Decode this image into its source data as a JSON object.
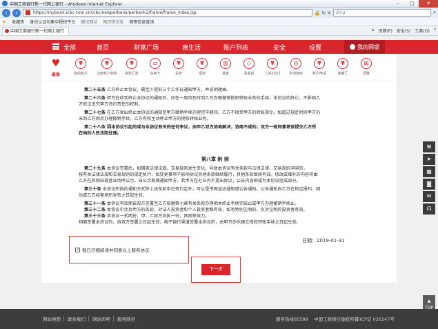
{
  "browser": {
    "title": "中国工商银行新一代网上银行 - Windows Internet Explorer",
    "url": "https://mybank.icbc.com.cn/icbc/newperbank/perbank3/frame/frame_index.jsp",
    "search_placeholder": "Bing",
    "favorites_label": "收藏夹",
    "favorites": [
      "身份认证与集中授权平台",
      "建议网站",
      "网页快讯库",
      "邮寄信息查询"
    ],
    "tab_title": "中国工商银行新一代网上银行",
    "commands": [
      "页面(P)",
      "安全(S)",
      "工具(O)"
    ]
  },
  "nav": {
    "all": "全部",
    "items": [
      "首页",
      "财富广场",
      "惠生活",
      "账户列表",
      "安全",
      "设置"
    ],
    "mybank": "我的网银"
  },
  "quick": [
    {
      "label": "最爱",
      "icon": "♥"
    },
    {
      "label": "我的账户",
      "icon": "¥"
    },
    {
      "label": "注册账户转账",
      "icon": "¥"
    },
    {
      "label": "转账汇款",
      "icon": "¥"
    },
    {
      "label": "信用卡",
      "icon": "▭"
    },
    {
      "label": "贷款",
      "icon": "¥"
    },
    {
      "label": "理财",
      "icon": "¥"
    },
    {
      "label": "基金",
      "icon": "▥"
    },
    {
      "label": "贵金属",
      "icon": "◇"
    },
    {
      "label": "工资e支付",
      "icon": "¥"
    },
    {
      "label": "本地特色",
      "icon": "◎"
    },
    {
      "label": "账户申请",
      "icon": "¥"
    },
    {
      "label": "储蓄汇",
      "icon": "¥"
    },
    {
      "label": "调整",
      "icon": "⊞"
    }
  ],
  "agreement": {
    "p25_head": "第二十五条",
    "p25": "乙方终止本协议，需至少提前三个工作日通知甲方，并说明理由。",
    "p26_head": "第二十六条",
    "p26a": "甲方在收到终止本协议的通知后，应在一周内及时到乙方办理撤销授权转账业务的手续。本协议的终止，不影响乙",
    "p26b": "方依法追究甲方违约责任的权利。",
    "p27_head": "第二十七条",
    "p27a": "在乙方发出终止本协议的通知至甲方撤销手续办理完毕期间，乙方不接受甲方的转账指令。如超过规定时间甲方仍",
    "p27b": "未到乙方网点办理撤销手续，乙方有权主动停止甲方的授权转账业务。",
    "p28_head": "第二十八条",
    "p28a": "因本协议引起的或与本协议有关的任何争议，由甲乙双方协商解决；协商不成的，双方一致同意将该提交乙方所",
    "p28b": "在地的人民法院处理。",
    "chapter8": "第八章 附 则",
    "p29_head": "第二十九条",
    "p29a": "本协议签署后，如国家法律法规、交易规则发生变化，导致本协议有关条款与法律法律、交易规则冲突的，",
    "p29b": "按有关法律法规和交易规则的规定执行，如变更事项不影响协议其他条款继续履行，其他条款继续有效。修改或增补的内容将由",
    "p29c": "乙方在其网站或营业场所公示，自公示期满通知甲方，若甲方在七日内不提出异议，公告内容即成为本协议组成部分。",
    "p30_head": "第三十条",
    "p30a": "本协议所指的通知方式除上述条款中已有约定外，可以是书面送达通知或公告通知。公告通知自乙方在指定报刊、网",
    "p30b": "站或乙方经营场所发布之日起生效。",
    "p31_head": "第三十一条",
    "p31": "本协议有效期自双方签署至乙方依据第七章有关条款办理相关终止手续完结止或甲方办理撤销手续止。",
    "p32_head": "第三十二条",
    "p32": "本协议中涉及甲方的条款，对法人投资者和个人投资者都有效，如有特别注明的，仅对注明的投资者有效。",
    "p33_head": "第三十三条",
    "p33": "本协议一式两份，甲、乙双方各执一份，具同等效力。",
    "p34": "相面签署本协议的，自双方签署之日起生效；电子银行渠道签署本协议的，由甲方办乐建立授权转账手续之日起生效。",
    "date": "日期：2019-01-31",
    "agree_label": "我已仔细阅读并同意以上服务协议",
    "next": "下一步"
  },
  "footer": {
    "links": [
      "网站地图",
      "联系我们",
      "网站声明",
      "服务网点"
    ],
    "hotline": "服务热线95588",
    "copyright": "中国工商银行版权所有",
    "icp": "京ICP证 030247号"
  },
  "top_label": "TOP"
}
